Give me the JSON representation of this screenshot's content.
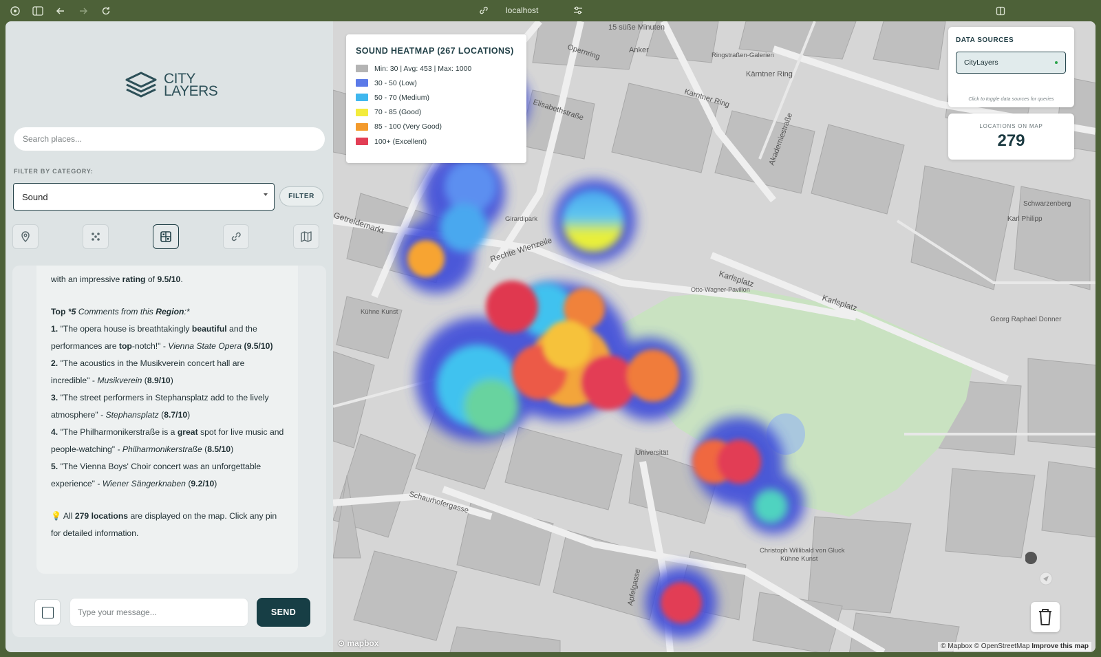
{
  "browser": {
    "url": "localhost",
    "icons": [
      "ubuntu-icon",
      "sidebar-toggle-icon",
      "back-icon",
      "forward-icon",
      "reload-icon",
      "link-icon",
      "tune-icon",
      "split-view-icon"
    ]
  },
  "sidebar": {
    "logo": {
      "line1": "CITY",
      "line2": "LAYERS"
    },
    "search_placeholder": "Search places...",
    "filter_label": "FILTER BY CATEGORY:",
    "category_selected": "Sound",
    "filter_button": "FILTER",
    "tools": [
      "pin-icon",
      "cluster-icon",
      "heatmap-grid-icon",
      "link-icon",
      "map-icon"
    ],
    "active_tool": "heatmap-grid-icon"
  },
  "chat": {
    "intro": {
      "pre": "with an impressive ",
      "bold": "rating",
      "mid": " of ",
      "rating": "9.5/10",
      "post": "."
    },
    "comments_header": {
      "top": "Top",
      "count": "*5",
      "mid": "Comments from this",
      "region": "Region",
      "star": ":*"
    },
    "comments": [
      {
        "num": "1.",
        "text_a": "\"The opera house is breathtakingly ",
        "bold_a": "beautiful",
        "text_b": " and the performances are ",
        "bold_b": "top",
        "text_c": "-notch!\" - ",
        "place": "Vienna State Opera",
        "rating": "(9.5/10)"
      },
      {
        "num": "2.",
        "text": "\"The acoustics in the Musikverein concert hall are incredible\" - ",
        "place": "Musikverein",
        "rating_open": "(",
        "rating": "8.9/10",
        "rating_close": ")"
      },
      {
        "num": "3.",
        "text": "\"The street performers in Stephansplatz add to the lively atmosphere\" - ",
        "place": "Stephansplatz",
        "rating_open": "(",
        "rating": "8.7/10",
        "rating_close": ")"
      },
      {
        "num": "4.",
        "text_a": "\"The Philharmonikerstraße is a ",
        "bold_a": "great",
        "text_b": " spot for live music and people-watching\" - ",
        "place": "Philharmonikerstraße",
        "rating_open": "(",
        "rating": "8.5/10",
        "rating_close": ")"
      },
      {
        "num": "5.",
        "text": "\"The Vienna Boys' Choir concert was an unforgettable experience\" - ",
        "place": "Wiener Sängerknaben",
        "rating_open": "(",
        "rating": "9.2/10",
        "rating_close": ")"
      }
    ],
    "footer": {
      "icon": "💡",
      "pre": " All ",
      "bold": "279 locations",
      "post": " are displayed on the map. Click any pin for detailed information."
    },
    "input_placeholder": "Type your message...",
    "send_label": "SEND"
  },
  "legend": {
    "title": "SOUND HEATMAP (267 LOCATIONS)",
    "items": [
      {
        "label": "Min: 30 | Avg: 453 | Max: 1000",
        "color": "#b4b4b4"
      },
      {
        "label": "30 - 50 (Low)",
        "color": "#5b7ae8"
      },
      {
        "label": "50 - 70 (Medium)",
        "color": "#3fb7ee"
      },
      {
        "label": "70 - 85 (Good)",
        "color": "#f3ec3c"
      },
      {
        "label": "85 - 100 (Very Good)",
        "color": "#f39a2c"
      },
      {
        "label": "100+ (Excellent)",
        "color": "#e23e55"
      }
    ]
  },
  "data_sources": {
    "title": "DATA SOURCES",
    "source": "CityLayers",
    "hint": "Click to toggle data sources for queries"
  },
  "locations": {
    "title": "LOCATIONS ON MAP",
    "count": "279"
  },
  "map_labels": [
    "15 süße Minuten",
    "Opernring",
    "Anker",
    "Ringstraßen-Galerien",
    "Kärntner Ring",
    "Karntner Ring",
    "Akademiestraße",
    "Elisabethstraße",
    "Getreidemarkt",
    "Rechte Wienzeile",
    "Girardipark",
    "Karlsplatz",
    "Karlsplatz",
    "Otto-Wagner-Pavillon",
    "Georg Raphael Donner",
    "Karl Philipp",
    "Schwarzenberg",
    "Universität",
    "Schaurhofergasse",
    "Apfelgasse",
    "Christoph Willibald von Gluck",
    "Kühne Kunst"
  ],
  "attribution": {
    "text": "© Mapbox © OpenStreetMap",
    "improve": "Improve this map"
  },
  "mapbox": "mapbox"
}
